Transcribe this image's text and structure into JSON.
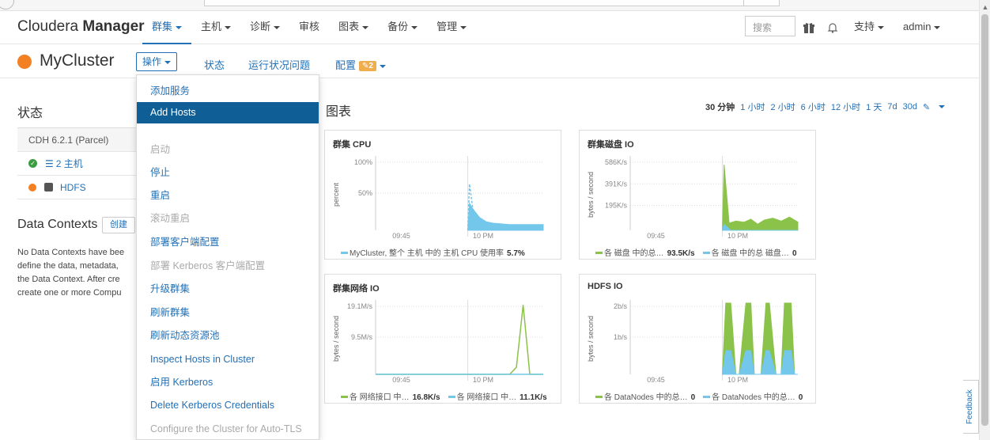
{
  "nav": {
    "brand_light": "Cloudera",
    "brand_bold": "Manager",
    "items": [
      {
        "label": "群集",
        "caret": true,
        "active": true
      },
      {
        "label": "主机",
        "caret": true
      },
      {
        "label": "诊断",
        "caret": true
      },
      {
        "label": "审核",
        "caret": false
      },
      {
        "label": "图表",
        "caret": true
      },
      {
        "label": "备份",
        "caret": true
      },
      {
        "label": "管理",
        "caret": true
      }
    ],
    "search_placeholder": "搜索",
    "right_items": [
      {
        "label": "支持",
        "caret": true
      },
      {
        "label": "admin",
        "caret": true
      }
    ]
  },
  "cluster": {
    "name": "MyCluster",
    "actions_label": "操作",
    "tabs": [
      {
        "label": "状态"
      },
      {
        "label": "运行状况问题"
      },
      {
        "label": "配置"
      }
    ],
    "config_badge": "2"
  },
  "status_section": {
    "title": "状态",
    "cdh_version": "CDH 6.2.1 (Parcel)",
    "hosts_label": "2 主机",
    "hdfs_label": "HDFS"
  },
  "data_contexts": {
    "title": "Data Contexts",
    "create_label": "创建",
    "lines": [
      "No Data Contexts have bee",
      "define the data, metadata,",
      "the Data Context. After cre",
      "create one or more Compu"
    ]
  },
  "actions_menu": [
    {
      "label": "添加服务",
      "state": "normal"
    },
    {
      "label": "Add Hosts",
      "state": "highlight"
    },
    {
      "label": "启动",
      "state": "disabled"
    },
    {
      "label": "停止",
      "state": "normal"
    },
    {
      "label": "重启",
      "state": "normal"
    },
    {
      "label": "滚动重启",
      "state": "disabled"
    },
    {
      "label": "部署客户端配置",
      "state": "normal"
    },
    {
      "label": "部署 Kerberos 客户端配置",
      "state": "disabled"
    },
    {
      "label": "升级群集",
      "state": "normal"
    },
    {
      "label": "刷新群集",
      "state": "normal"
    },
    {
      "label": "刷新动态资源池",
      "state": "normal"
    },
    {
      "label": "Inspect Hosts in Cluster",
      "state": "normal"
    },
    {
      "label": "启用 Kerberos",
      "state": "normal"
    },
    {
      "label": "Delete Kerberos Credentials",
      "state": "normal"
    },
    {
      "label": "Configure the Cluster for Auto-TLS",
      "state": "disabled"
    }
  ],
  "charts_section": {
    "title": "图表",
    "time_ranges": [
      "30 分钟",
      "1 小时",
      "2 小时",
      "6 小时",
      "12 小时",
      "1 天",
      "7d",
      "30d"
    ],
    "current_range": "30 分钟"
  },
  "chart_data": [
    {
      "type": "area",
      "title": "群集 CPU",
      "ylabel": "percent",
      "yticks": [
        "100%",
        "50%"
      ],
      "ylim": [
        0,
        100
      ],
      "xticks": [
        "09:45",
        "10 PM"
      ],
      "series": [
        {
          "name": "MyCluster, 整个 主机 中的 主机 CPU 使用率",
          "color": "#72c7ea",
          "summary": "5.7%",
          "x": [
            0.55,
            0.56,
            0.58,
            0.62,
            0.66,
            0.7,
            0.75,
            0.8,
            0.85,
            0.9,
            1.0
          ],
          "values": [
            0,
            38,
            30,
            18,
            12,
            10,
            9,
            8,
            8,
            8,
            8
          ]
        },
        {
          "name": "",
          "color": "#72c7ea",
          "dashed": true,
          "x": [
            0.55,
            0.56,
            0.58,
            0.6,
            0.64
          ],
          "values": [
            0,
            65,
            30,
            20,
            12
          ]
        }
      ]
    },
    {
      "type": "area",
      "title": "群集磁盘 IO",
      "ylabel": "bytes / second",
      "yticks": [
        "586K/s",
        "391K/s",
        "195K/s"
      ],
      "ylim": [
        0,
        700
      ],
      "xticks": [
        "09:45",
        "10 PM"
      ],
      "series": [
        {
          "name": "各 磁盘 中的总…",
          "color": "#8bc34a",
          "summary": "93.5K/s",
          "x": [
            0.55,
            0.56,
            0.59,
            0.63,
            0.68,
            0.72,
            0.76,
            0.8,
            0.85,
            0.9,
            0.95,
            1.0
          ],
          "values": [
            0,
            645,
            70,
            90,
            80,
            110,
            60,
            100,
            120,
            90,
            130,
            80
          ]
        },
        {
          "name": "各 磁盘 中的总 磁盘…",
          "color": "#72c7ea",
          "summary": "0",
          "x": [
            0.55,
            0.56,
            0.6,
            1.0
          ],
          "values": [
            0,
            60,
            0,
            0
          ]
        }
      ]
    },
    {
      "type": "line",
      "title": "群集网络 IO",
      "ylabel": "bytes / second",
      "yticks": [
        "19.1M/s",
        "9.5M/s"
      ],
      "ylim": [
        0,
        20
      ],
      "xticks": [
        "09:45",
        "10 PM"
      ],
      "series": [
        {
          "name": "各 网络接口 中…",
          "color": "#8bc34a",
          "summary": "16.8K/s",
          "x": [
            0,
            0.8,
            0.84,
            0.88,
            0.92,
            0.96,
            1.0
          ],
          "values": [
            0,
            0,
            2,
            19.5,
            0,
            0,
            0
          ]
        },
        {
          "name": "各 网络接口 中…",
          "color": "#72c7ea",
          "summary": "11.1K/s",
          "x": [
            0,
            1.0
          ],
          "values": [
            0,
            0
          ]
        }
      ]
    },
    {
      "type": "area",
      "title": "HDFS IO",
      "ylabel": "bytes / second",
      "yticks": [
        "2b/s",
        "1b/s"
      ],
      "ylim": [
        0,
        3
      ],
      "xticks": [
        "09:45",
        "10 PM"
      ],
      "series": [
        {
          "name": "各 DataNodes 中的总…",
          "color": "#8bc34a",
          "summary": "0",
          "x": [
            0.55,
            0.57,
            0.6,
            0.63,
            0.65,
            0.69,
            0.72,
            0.74,
            0.78,
            0.81,
            0.83,
            0.87,
            0.9,
            0.92,
            0.96,
            0.98,
            1.0
          ],
          "values": [
            0,
            3,
            3,
            0,
            0,
            3,
            3,
            0,
            0,
            3,
            3,
            0,
            0,
            3,
            3,
            0,
            0
          ]
        },
        {
          "name": "各 DataNodes 中的总…",
          "color": "#72c7ea",
          "summary": "0",
          "x": [
            0.55,
            0.57,
            0.6,
            0.63,
            0.65,
            0.69,
            0.72,
            0.74,
            0.78,
            0.81,
            0.83,
            0.87,
            0.9,
            0.92,
            0.96,
            0.98,
            1.0
          ],
          "values": [
            0,
            1,
            1,
            0,
            0,
            1,
            1,
            0,
            0,
            1,
            1,
            0,
            0,
            1,
            1,
            0,
            0
          ]
        }
      ]
    }
  ],
  "feedback_label": "Feedback"
}
